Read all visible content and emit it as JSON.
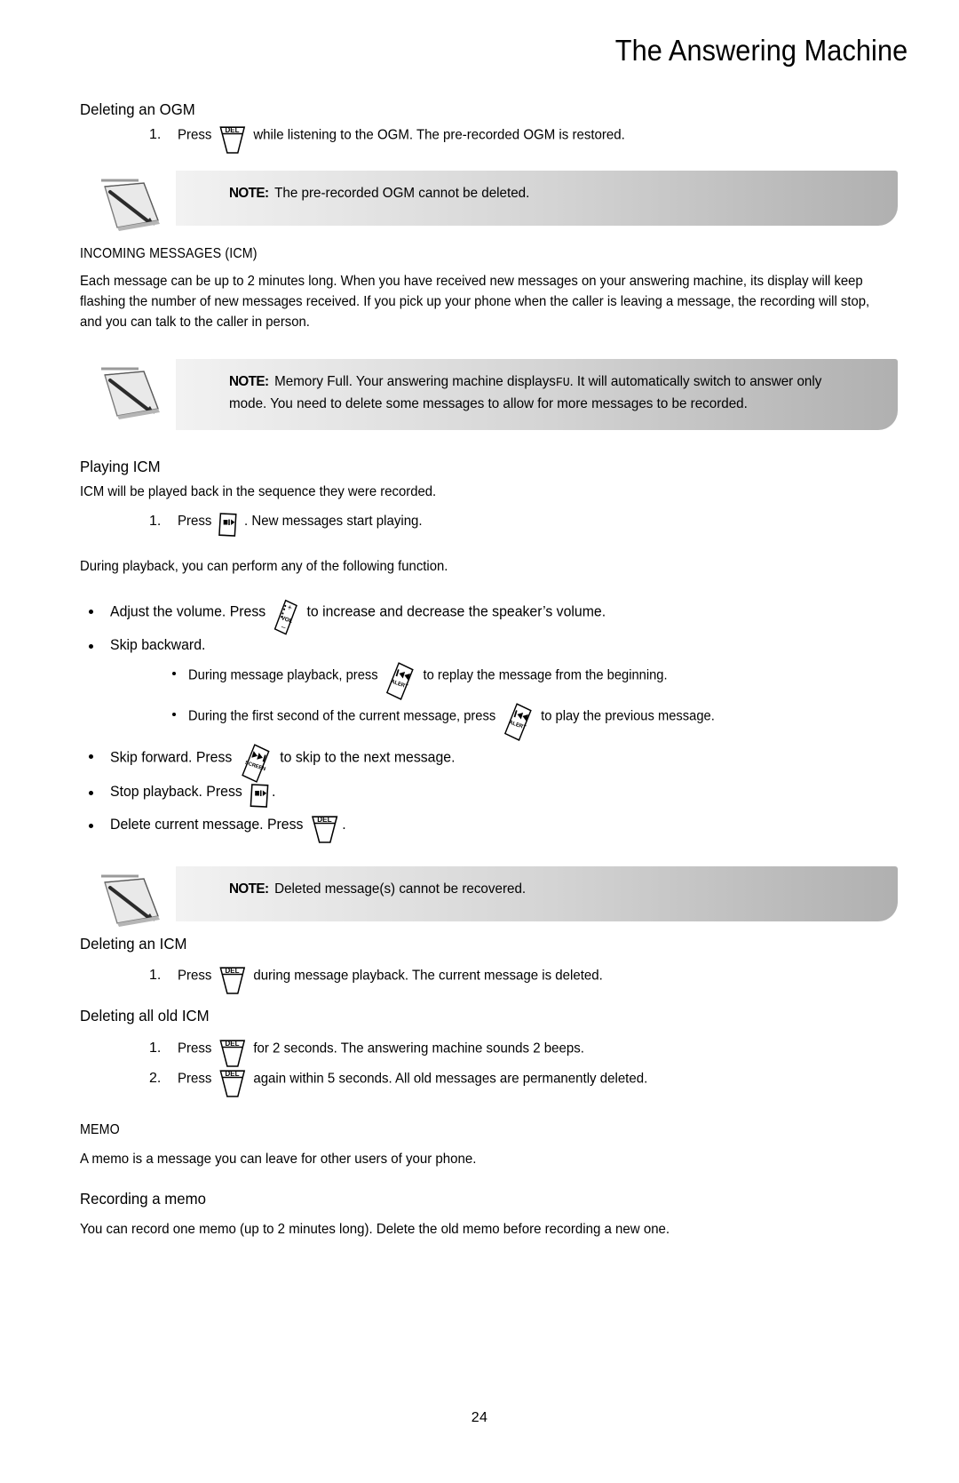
{
  "header": {
    "title": "The Answering Machine"
  },
  "sections": {
    "deleting_ogm": {
      "heading": "Deleting an OGM",
      "step1_num": "1.",
      "step1_pre": "Press",
      "step1_post": "while listening to the OGM. The pre-recorded OGM is restored."
    },
    "note1": {
      "label": "NOTE:",
      "text": "The pre-recorded OGM cannot be deleted."
    },
    "icm": {
      "heading": "INCOMING MESSAGES (ICM)",
      "body": "Each message can be up to 2 minutes long. When you have received new messages on your answering machine, its display will keep flashing the number of new messages received. If you pick up your phone when the caller is leaving a message, the recording will stop, and you can talk to the caller in person."
    },
    "note2": {
      "label": "NOTE:",
      "text_a": "Memory Full. Your answering machine displays",
      "display_code": "FU",
      "text_b": ". It will automatically switch to answer only mode. You need to delete some messages to allow for more messages to be recorded."
    },
    "playing_icm": {
      "heading": "Playing ICM",
      "intro": "ICM will be played back in the sequence they were recorded.",
      "step1_num": "1.",
      "step1_pre": "Press",
      "step1_post": ". New messages start playing.",
      "during": "During playback, you can perform any of the following function.",
      "bullets": {
        "volume_pre": "Adjust the volume. Press",
        "volume_post": "to increase and decrease the speaker’s volume.",
        "skip_backward": "Skip backward.",
        "sub1_pre": "During message playback, press",
        "sub1_post": "to replay the message from the beginning.",
        "sub2_pre": "During the first second of the current message, press",
        "sub2_post": "to play the previous message.",
        "skip_forward_pre": "Skip forward. Press",
        "skip_forward_post": "to skip to the next message.",
        "stop_pre": "Stop playback. Press",
        "stop_post": ".",
        "delete_pre": "Delete current message. Press",
        "delete_post": "."
      }
    },
    "note3": {
      "label": "NOTE:",
      "text": "Deleted message(s) cannot be recovered."
    },
    "deleting_icm": {
      "heading": "Deleting an ICM",
      "step1_num": "1.",
      "step1_pre": "Press",
      "step1_post": "during message playback. The current message is deleted."
    },
    "deleting_all_old_icm": {
      "heading": "Deleting all old ICM",
      "step1_num": "1.",
      "step1_pre": "Press",
      "step1_post": "for 2 seconds. The answering machine sounds 2 beeps.",
      "step2_num": "2.",
      "step2_pre": "Press",
      "step2_post": "again within 5 seconds. All old messages are permanently deleted."
    },
    "memo": {
      "heading": "MEMO",
      "body": "A memo is a message you can leave for other users of your phone."
    },
    "recording_memo": {
      "heading": "Recording a memo",
      "body": "You can record one memo (up to 2 minutes long). Delete the old memo before recording a new one."
    }
  },
  "keys": {
    "del_label": "DEL",
    "vol_label": "VOL",
    "vol_plus": "+",
    "vol_minus": "–",
    "alert_label": "ALERT",
    "screen_label": "SCREEN",
    "skip_back_glyph": "◀◀",
    "skip_fwd_glyph": "▶▶",
    "play_stop_glyph": "■ ▶"
  },
  "footer": {
    "page_number": "24"
  },
  "colors": {
    "text": "#000000",
    "note_gradient_start": "#f2f2f2",
    "note_gradient_end": "#b0b0b0",
    "page_background": "#ffffff"
  }
}
